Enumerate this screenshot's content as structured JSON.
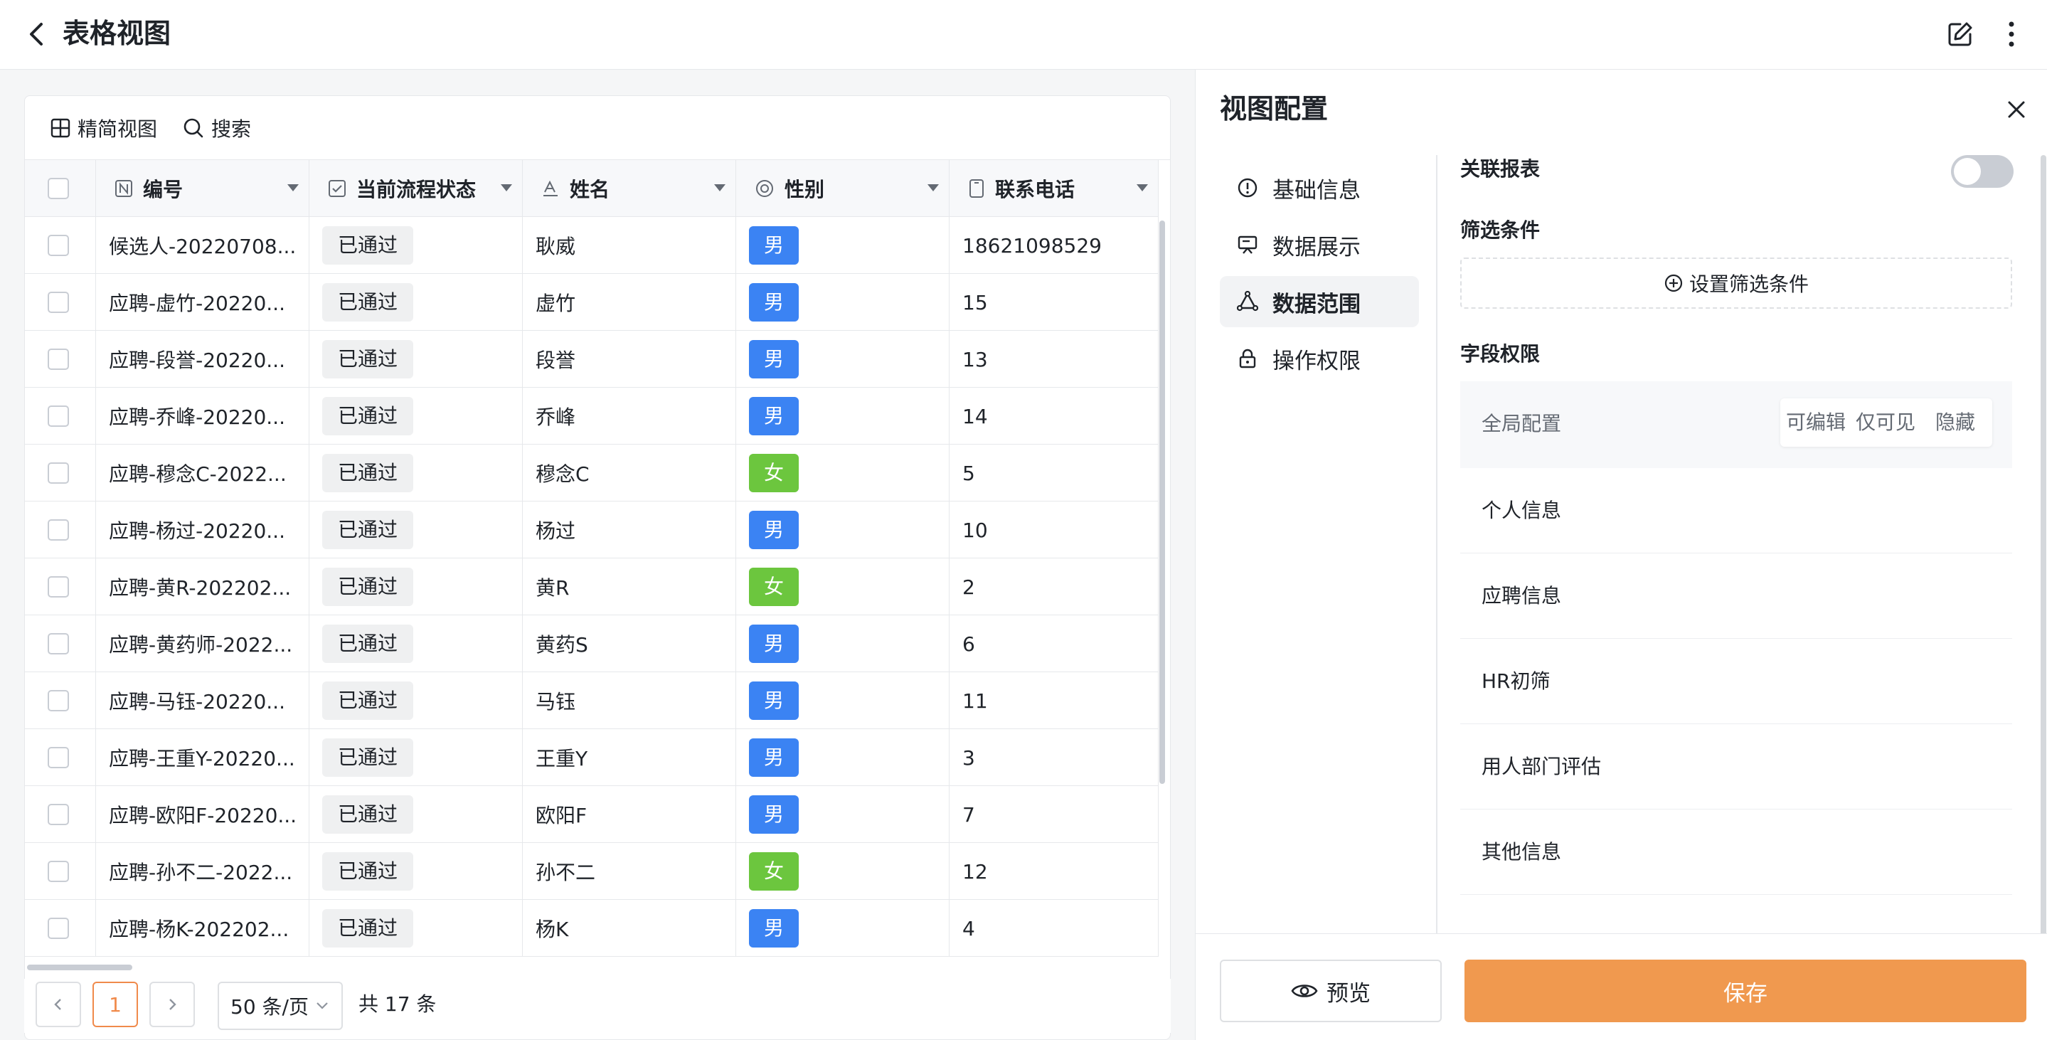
{
  "header": {
    "title": "表格视图"
  },
  "toolbar": {
    "compact_view_label": "精简视图",
    "search_label": "搜索"
  },
  "table": {
    "columns": [
      {
        "key": "id",
        "label": "编号",
        "icon": "number-field-icon"
      },
      {
        "key": "status",
        "label": "当前流程状态",
        "icon": "checkbox-field-icon"
      },
      {
        "key": "name",
        "label": "姓名",
        "icon": "text-field-icon"
      },
      {
        "key": "gender",
        "label": "性别",
        "icon": "radio-field-icon"
      },
      {
        "key": "phone",
        "label": "联系电话",
        "icon": "phone-field-icon"
      }
    ],
    "rows": [
      {
        "id": "候选人-20220708...",
        "status": "已通过",
        "name": "耿威",
        "gender": "男",
        "phone": "18621098529"
      },
      {
        "id": "应聘-虚竹-20220...",
        "status": "已通过",
        "name": "虚竹",
        "gender": "男",
        "phone": "15"
      },
      {
        "id": "应聘-段誉-20220...",
        "status": "已通过",
        "name": "段誉",
        "gender": "男",
        "phone": "13"
      },
      {
        "id": "应聘-乔峰-20220...",
        "status": "已通过",
        "name": "乔峰",
        "gender": "男",
        "phone": "14"
      },
      {
        "id": "应聘-穆念C-2022...",
        "status": "已通过",
        "name": "穆念C",
        "gender": "女",
        "phone": "5"
      },
      {
        "id": "应聘-杨过-20220...",
        "status": "已通过",
        "name": "杨过",
        "gender": "男",
        "phone": "10"
      },
      {
        "id": "应聘-黄R-202202...",
        "status": "已通过",
        "name": "黄R",
        "gender": "女",
        "phone": "2"
      },
      {
        "id": "应聘-黄药师-2022...",
        "status": "已通过",
        "name": "黄药S",
        "gender": "男",
        "phone": "6"
      },
      {
        "id": "应聘-马钰-20220...",
        "status": "已通过",
        "name": "马钰",
        "gender": "男",
        "phone": "11"
      },
      {
        "id": "应聘-王重Y-20220...",
        "status": "已通过",
        "name": "王重Y",
        "gender": "男",
        "phone": "3"
      },
      {
        "id": "应聘-欧阳F-20220...",
        "status": "已通过",
        "name": "欧阳F",
        "gender": "男",
        "phone": "7"
      },
      {
        "id": "应聘-孙不二-2022...",
        "status": "已通过",
        "name": "孙不二",
        "gender": "女",
        "phone": "12"
      },
      {
        "id": "应聘-杨K-202202...",
        "status": "已通过",
        "name": "杨K",
        "gender": "男",
        "phone": "4"
      }
    ]
  },
  "colors": {
    "male": "#3b83f3",
    "female": "#6cc63e",
    "accent": "#f0994f"
  },
  "pagination": {
    "current_page": "1",
    "page_size": "50 条/页",
    "total": "共 17 条"
  },
  "panel": {
    "title": "视图配置",
    "nav": [
      {
        "label": "基础信息",
        "icon": "info-circle-icon",
        "active": false
      },
      {
        "label": "数据展示",
        "icon": "display-icon",
        "active": false
      },
      {
        "label": "数据范围",
        "icon": "data-scope-icon",
        "active": true
      },
      {
        "label": "操作权限",
        "icon": "lock-icon",
        "active": false
      }
    ],
    "linked_report_label": "关联报表",
    "linked_report_enabled": false,
    "filter_label": "筛选条件",
    "filter_button": "设置筛选条件",
    "field_permission_label": "字段权限",
    "global_config_label": "全局配置",
    "perm_options": [
      "可编辑",
      "仅可见",
      "隐藏"
    ],
    "field_groups": [
      "个人信息",
      "应聘信息",
      "HR初筛",
      "用人部门评估",
      "其他信息"
    ],
    "preview_label": "预览",
    "save_label": "保存"
  }
}
